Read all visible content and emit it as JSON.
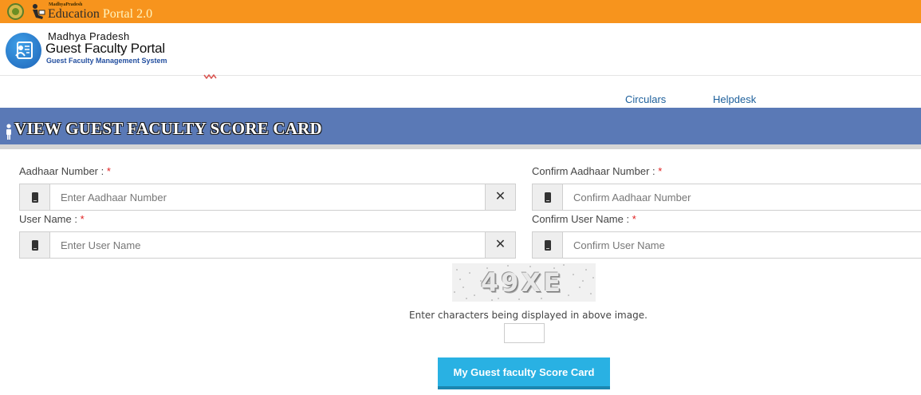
{
  "top_bar": {
    "state_small": "MadhyaPradesh",
    "portal_name_part1": "Education",
    "portal_name_part2": " Portal 2.0",
    "colors": {
      "background": "#f7941d"
    }
  },
  "logo": {
    "line1": "Madhya Pradesh",
    "line2": "Guest Faculty Portal",
    "line3": "Guest Faculty Management System",
    "icon": "faculty-logo-icon"
  },
  "nav": {
    "links": [
      {
        "label": "Circulars"
      },
      {
        "label": "Helpdesk"
      }
    ]
  },
  "heading": {
    "title": "VIEW GUEST FACULTY SCORE CARD",
    "icon": "person-icon",
    "colors": {
      "background": "#5a79b6"
    }
  },
  "form": {
    "aadhaar": {
      "label": "Aadhaar Number : ",
      "required": "*",
      "placeholder": "Enter Aadhaar Number",
      "value": ""
    },
    "confirm_aadhaar": {
      "label": "Confirm Aadhaar Number : ",
      "required": "*",
      "placeholder": "Confirm Aadhaar Number",
      "value": ""
    },
    "username": {
      "label": "User Name : ",
      "required": "*",
      "placeholder": "Enter User Name",
      "value": ""
    },
    "confirm_username": {
      "label": "Confirm User Name : ",
      "required": "*",
      "placeholder": "Confirm User Name",
      "value": ""
    },
    "clear_symbol": "✕",
    "field_icon": "mobile-phone-icon"
  },
  "captcha": {
    "text": "49XE",
    "hint": "Enter characters being displayed in above image.",
    "value": ""
  },
  "submit": {
    "label": "My Guest faculty Score Card",
    "colors": {
      "background": "#29b1e3"
    }
  }
}
